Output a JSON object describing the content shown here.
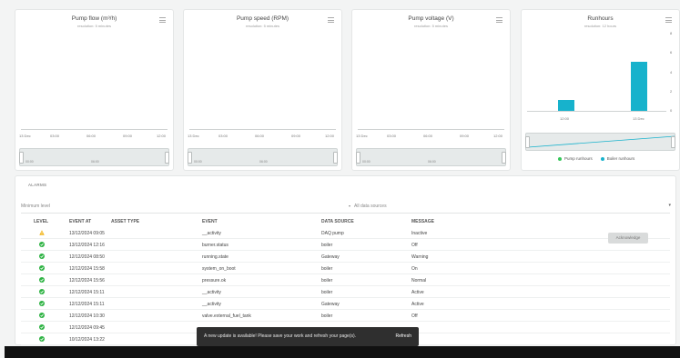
{
  "charts": [
    {
      "title": "Pump flow (m³/h)",
      "subtitle": "resolution: 5 minutes",
      "x_ticks": [
        "13 Dec",
        "03:00",
        "06:00",
        "09:00",
        "12:00"
      ],
      "nav_ticks": [
        "00:00",
        "06:00"
      ]
    },
    {
      "title": "Pump speed (RPM)",
      "subtitle": "resolution: 5 minutes",
      "x_ticks": [
        "13 Dec",
        "03:00",
        "06:00",
        "09:00",
        "12:00"
      ],
      "nav_ticks": [
        "00:00",
        "06:00"
      ]
    },
    {
      "title": "Pump voltage (V)",
      "subtitle": "resolution: 5 minutes",
      "x_ticks": [
        "13 Dec",
        "03:00",
        "06:00",
        "09:00",
        "12:00"
      ],
      "nav_ticks": [
        "00:00",
        "06:00"
      ]
    },
    {
      "title": "Runhours",
      "subtitle": "resolution: 12 hours",
      "x_ticks": [
        "12:00",
        "13 Dec"
      ],
      "y_ticks": [
        "8",
        "6",
        "4",
        "2",
        "0"
      ],
      "legend": [
        "Pump runhours",
        "Boiler runhours"
      ]
    }
  ],
  "chart_data": {
    "type": "bar",
    "categories": [
      "12:00",
      "13 Dec"
    ],
    "series": [
      {
        "name": "Pump runhours",
        "values": [
          0,
          0
        ],
        "color": "#34c759"
      },
      {
        "name": "Boiler runhours",
        "values": [
          1.1,
          5.1
        ],
        "color": "#17b2cc"
      }
    ],
    "ylim": [
      0,
      8
    ]
  },
  "alarms": {
    "title": "ALARMS",
    "filter_level": "Minimum level",
    "filter_source": "All data sources",
    "columns": [
      "LEVEL",
      "EVENT AT",
      "ASSET TYPE",
      "EVENT",
      "DATA SOURCE",
      "MESSAGE"
    ],
    "acknowledge_label": "Acknowledge",
    "rows": [
      {
        "level": "warning",
        "event_at": "13/12/2024 09:05",
        "event": "__activity",
        "source": "DAQ pump",
        "message": "Inactive"
      },
      {
        "level": "ok",
        "event_at": "13/12/2024 12:16",
        "event": "burner.status",
        "source": "boiler",
        "message": "Off"
      },
      {
        "level": "ok",
        "event_at": "12/12/2024 08:50",
        "event": "running.state",
        "source": "Gateway",
        "message": "Warning"
      },
      {
        "level": "ok",
        "event_at": "12/12/2024 15:58",
        "event": "system_on_boot",
        "source": "boiler",
        "message": "On"
      },
      {
        "level": "ok",
        "event_at": "12/12/2024 15:56",
        "event": "pressure.ok",
        "source": "boiler",
        "message": "Normal"
      },
      {
        "level": "ok",
        "event_at": "12/12/2024 15:11",
        "event": "__activity",
        "source": "boiler",
        "message": "Active"
      },
      {
        "level": "ok",
        "event_at": "12/12/2024 15:11",
        "event": "__activity",
        "source": "Gateway",
        "message": "Active"
      },
      {
        "level": "ok",
        "event_at": "12/12/2024 10:30",
        "event": "valve.external_fuel_tank",
        "source": "boiler",
        "message": "Off"
      },
      {
        "level": "ok",
        "event_at": "12/12/2024 09:45",
        "event": "",
        "source": "",
        "message": ""
      },
      {
        "level": "ok",
        "event_at": "10/12/2024 13:22",
        "event": "",
        "source": "",
        "message": ""
      }
    ]
  },
  "toast": {
    "message": "A new update is available! Please save your work and refresh your page(s).",
    "action": "Refresh"
  },
  "colors": {
    "ok": "#2fb344",
    "warning": "#f2b51c",
    "bar": "#17b2cc"
  }
}
